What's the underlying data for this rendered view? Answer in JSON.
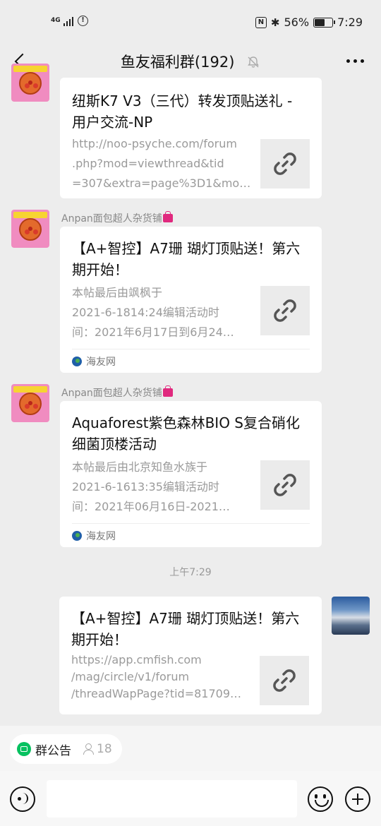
{
  "status_bar": {
    "network": "4G",
    "battery_percent": "56%",
    "battery_level": 0.56,
    "time": "7:29"
  },
  "header": {
    "title": "鱼友福利群(192)"
  },
  "messages": [
    {
      "type": "link",
      "title": "纽斯K7 V3（三代）转发顶贴送礼 - 用户交流-NP",
      "desc_lines": [
        "http://noo-psyche.com/forum",
        ".php?mod=viewthread&tid",
        "=307&extra=page%3D1&mo…"
      ]
    },
    {
      "type": "link",
      "sender": "Anpan面包超人杂货铺",
      "title": "【A+智控】A7珊 瑚灯顶贴送！第六期开始！",
      "desc_lines": [
        "本帖最后由飒枫于",
        "2021-6-1814:24编辑活动时",
        "间：2021年6月17日到6月24…"
      ],
      "source": "海友网"
    },
    {
      "type": "link",
      "sender": "Anpan面包超人杂货铺",
      "title": "Aquaforest紫色森林BIO S复合硝化细菌顶楼活动",
      "desc_lines": [
        "本帖最后由北京知鱼水族于",
        "2021-6-1613:35编辑活动时",
        "间：2021年06月16日-2021…"
      ],
      "source": "海友网"
    },
    {
      "type": "link",
      "title": "【A+智控】A7珊 瑚灯顶贴送！第六期开始！",
      "desc_lines": [
        "https://app.cmfish.com",
        "/mag/circle/v1/forum",
        "/threadWapPage?tid=81709…"
      ]
    }
  ],
  "time_separator": "上午7:29",
  "notice": {
    "label": "群公告",
    "member_count": "18"
  },
  "input": {
    "value": ""
  }
}
